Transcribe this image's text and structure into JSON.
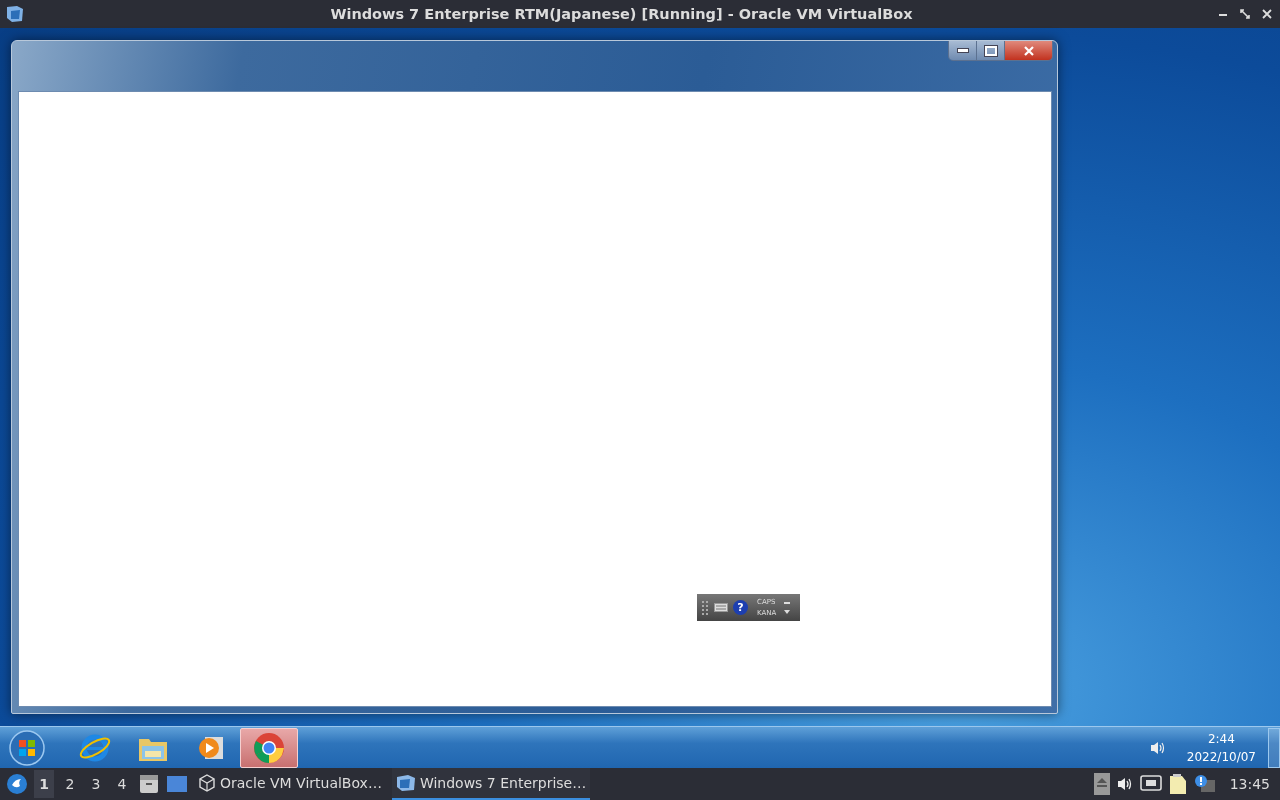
{
  "title_bar": {
    "title": "Windows 7 Enterprise RTM(Japanese) [Running] - Oracle VM VirtualBox"
  },
  "guest": {
    "ime_bar": {
      "help": "?",
      "caps": "CAPS",
      "kana": "KANA"
    },
    "taskbar": {
      "pinned": [
        {
          "kind": "ie",
          "active": false
        },
        {
          "kind": "explorer",
          "active": false
        },
        {
          "kind": "media",
          "active": false
        },
        {
          "kind": "chrome",
          "active": true
        }
      ],
      "clock": {
        "time": "2:44",
        "date": "2022/10/07"
      }
    }
  },
  "host_panel": {
    "workspaces": [
      {
        "label": "1",
        "selected": true
      },
      {
        "label": "2",
        "selected": false
      },
      {
        "label": "3",
        "selected": false
      },
      {
        "label": "4",
        "selected": false
      }
    ],
    "tasks": [
      {
        "kind": "virtualbox",
        "label": "Oracle VM VirtualBox…",
        "selected": false
      },
      {
        "kind": "vm",
        "label": "Windows 7 Enterprise…",
        "selected": true
      }
    ],
    "clock": "13:45"
  }
}
